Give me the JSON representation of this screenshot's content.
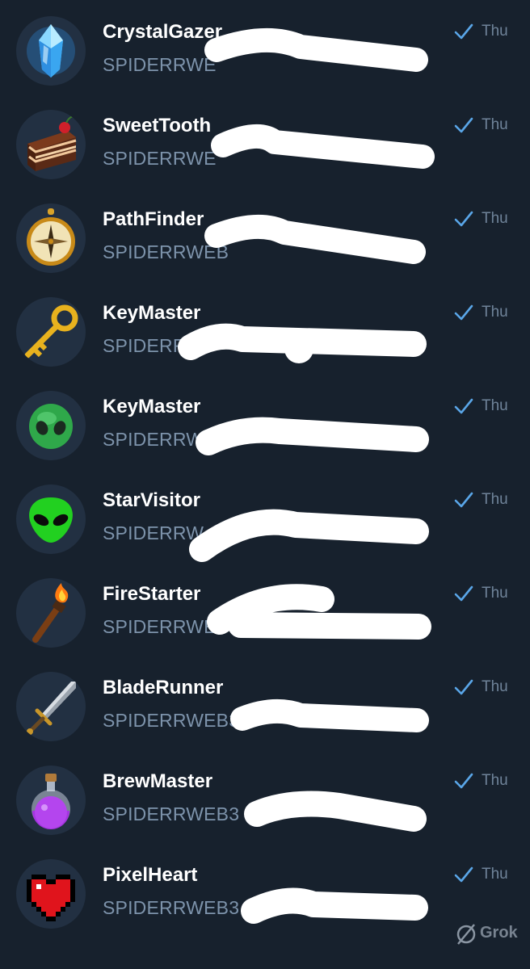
{
  "chats": [
    {
      "name": "CrystalGazer",
      "preview": "SPIDERRWE",
      "time": "Thu",
      "avatar_icon": "crystal-icon"
    },
    {
      "name": "SweetTooth",
      "preview": "SPIDERRWE",
      "time": "Thu",
      "avatar_icon": "cake-icon"
    },
    {
      "name": "PathFinder",
      "preview": "SPIDERRWEB",
      "time": "Thu",
      "avatar_icon": "compass-icon"
    },
    {
      "name": "KeyMaster",
      "preview": "SPIDERR",
      "time": "Thu",
      "avatar_icon": "key-icon"
    },
    {
      "name": "KeyMaster",
      "preview": "SPIDERRW",
      "time": "Thu",
      "avatar_icon": "green-alien-head-icon"
    },
    {
      "name": "StarVisitor",
      "preview": "SPIDERRW",
      "time": "Thu",
      "avatar_icon": "alien-face-icon"
    },
    {
      "name": "FireStarter",
      "preview": "SPIDERRWE",
      "time": "Thu",
      "avatar_icon": "torch-icon"
    },
    {
      "name": "BladeRunner",
      "preview": "SPIDERRWEB3",
      "time": "Thu",
      "avatar_icon": "sword-icon"
    },
    {
      "name": "BrewMaster",
      "preview": "SPIDERRWEB3",
      "time": "Thu",
      "avatar_icon": "potion-icon"
    },
    {
      "name": "PixelHeart",
      "preview": "SPIDERRWEB3",
      "time": "Thu",
      "avatar_icon": "pixel-heart-icon"
    }
  ],
  "watermark": "Grok",
  "colors": {
    "background": "#17212d",
    "name_text": "#ffffff",
    "preview_text": "#7d93ab",
    "check_mark": "#5aa6e8",
    "redaction": "#ffffff"
  }
}
